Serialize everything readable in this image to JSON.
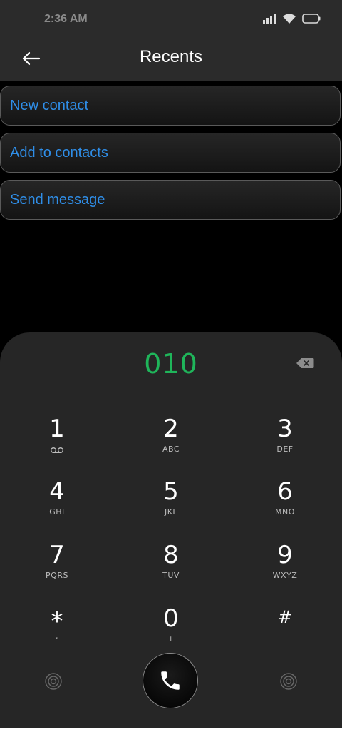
{
  "status_bar": {
    "time": "2:36 AM",
    "icons": [
      "signal-icon",
      "wifi-icon",
      "battery-icon"
    ]
  },
  "header": {
    "title": "Recents",
    "back_icon": "arrow-left-icon"
  },
  "actions": [
    {
      "label": "New contact"
    },
    {
      "label": "Add to contacts"
    },
    {
      "label": "Send message"
    }
  ],
  "dialpad": {
    "number": "010",
    "keys": [
      {
        "digit": "1",
        "letters": ""
      },
      {
        "digit": "2",
        "letters": "ABC"
      },
      {
        "digit": "3",
        "letters": "DEF"
      },
      {
        "digit": "4",
        "letters": "GHI"
      },
      {
        "digit": "5",
        "letters": "JKL"
      },
      {
        "digit": "6",
        "letters": "MNO"
      },
      {
        "digit": "7",
        "letters": "PQRS"
      },
      {
        "digit": "8",
        "letters": "TUV"
      },
      {
        "digit": "9",
        "letters": "WXYZ"
      },
      {
        "digit": "*",
        "letters": ","
      },
      {
        "digit": "0",
        "letters": "+"
      },
      {
        "digit": "#",
        "letters": ""
      }
    ]
  },
  "colors": {
    "accent_link": "#2f8ee8",
    "dialed_number": "#1fb55a",
    "panel": "#262626",
    "header": "#2b2b2b"
  }
}
